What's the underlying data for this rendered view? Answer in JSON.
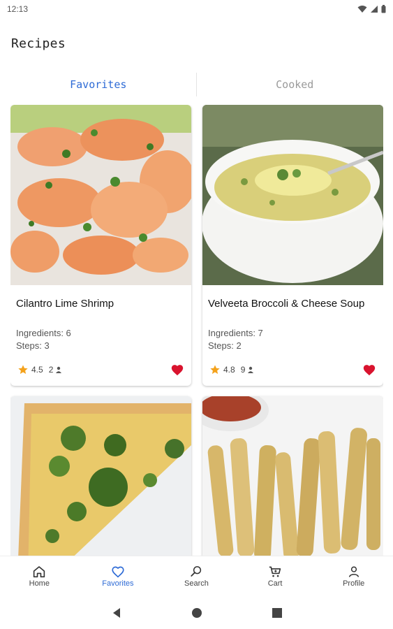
{
  "status_bar": {
    "time": "12:13"
  },
  "page": {
    "title": "Recipes"
  },
  "tabs": [
    {
      "label": "Favorites",
      "active": true
    },
    {
      "label": "Cooked",
      "active": false
    }
  ],
  "recipes": [
    {
      "name": "Cilantro Lime Shrimp",
      "ingredients": "Ingredients: 6",
      "steps": "Steps: 3",
      "rating": "4.5",
      "cooked": "2",
      "favorite": true
    },
    {
      "name": "Velveeta Broccoli & Cheese Soup",
      "ingredients": "Ingredients: 7",
      "steps": "Steps: 2",
      "rating": "4.8",
      "cooked": "9",
      "favorite": true
    },
    {
      "name": "",
      "image": "broccoli quiche"
    },
    {
      "name": "",
      "image": "zucchini fries"
    }
  ],
  "bottom_nav": [
    {
      "label": "Home",
      "icon": "home-icon"
    },
    {
      "label": "Favorites",
      "icon": "heart-icon",
      "active": true
    },
    {
      "label": "Search",
      "icon": "search-icon"
    },
    {
      "label": "Cart",
      "icon": "cart-icon"
    },
    {
      "label": "Profile",
      "icon": "person-icon"
    }
  ],
  "colors": {
    "accent": "#2e6bd6",
    "heart": "#d9132e",
    "star": "#f4a21b"
  }
}
